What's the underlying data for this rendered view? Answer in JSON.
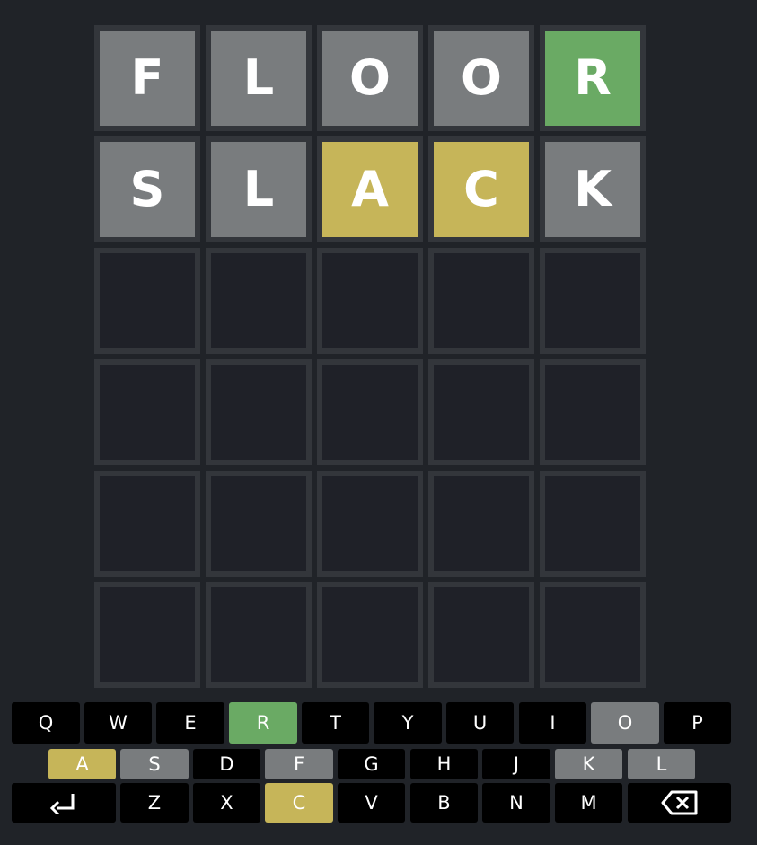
{
  "board": {
    "rows": [
      {
        "tiles": [
          {
            "letter": "F",
            "state": "absent"
          },
          {
            "letter": "L",
            "state": "absent"
          },
          {
            "letter": "O",
            "state": "absent"
          },
          {
            "letter": "O",
            "state": "absent"
          },
          {
            "letter": "R",
            "state": "correct"
          }
        ]
      },
      {
        "tiles": [
          {
            "letter": "S",
            "state": "absent"
          },
          {
            "letter": "L",
            "state": "absent"
          },
          {
            "letter": "A",
            "state": "present"
          },
          {
            "letter": "C",
            "state": "present"
          },
          {
            "letter": "K",
            "state": "absent"
          }
        ]
      },
      {
        "tiles": [
          {
            "letter": "",
            "state": "empty"
          },
          {
            "letter": "",
            "state": "empty"
          },
          {
            "letter": "",
            "state": "empty"
          },
          {
            "letter": "",
            "state": "empty"
          },
          {
            "letter": "",
            "state": "empty"
          }
        ]
      },
      {
        "tiles": [
          {
            "letter": "",
            "state": "empty"
          },
          {
            "letter": "",
            "state": "empty"
          },
          {
            "letter": "",
            "state": "empty"
          },
          {
            "letter": "",
            "state": "empty"
          },
          {
            "letter": "",
            "state": "empty"
          }
        ]
      },
      {
        "tiles": [
          {
            "letter": "",
            "state": "empty"
          },
          {
            "letter": "",
            "state": "empty"
          },
          {
            "letter": "",
            "state": "empty"
          },
          {
            "letter": "",
            "state": "empty"
          },
          {
            "letter": "",
            "state": "empty"
          }
        ]
      },
      {
        "tiles": [
          {
            "letter": "",
            "state": "empty"
          },
          {
            "letter": "",
            "state": "empty"
          },
          {
            "letter": "",
            "state": "empty"
          },
          {
            "letter": "",
            "state": "empty"
          },
          {
            "letter": "",
            "state": "empty"
          }
        ]
      }
    ]
  },
  "keyboard": {
    "rows": [
      [
        {
          "label": "Q",
          "state": "unused"
        },
        {
          "label": "W",
          "state": "unused"
        },
        {
          "label": "E",
          "state": "unused"
        },
        {
          "label": "R",
          "state": "correct"
        },
        {
          "label": "T",
          "state": "unused"
        },
        {
          "label": "Y",
          "state": "unused"
        },
        {
          "label": "U",
          "state": "unused"
        },
        {
          "label": "I",
          "state": "unused"
        },
        {
          "label": "O",
          "state": "absent"
        },
        {
          "label": "P",
          "state": "unused"
        }
      ],
      [
        {
          "label": "A",
          "state": "present"
        },
        {
          "label": "S",
          "state": "absent"
        },
        {
          "label": "D",
          "state": "unused"
        },
        {
          "label": "F",
          "state": "absent"
        },
        {
          "label": "G",
          "state": "unused"
        },
        {
          "label": "H",
          "state": "unused"
        },
        {
          "label": "J",
          "state": "unused"
        },
        {
          "label": "K",
          "state": "absent"
        },
        {
          "label": "L",
          "state": "absent"
        }
      ],
      [
        {
          "label": "",
          "icon": "enter-icon",
          "state": "unused"
        },
        {
          "label": "Z",
          "state": "unused"
        },
        {
          "label": "X",
          "state": "unused"
        },
        {
          "label": "C",
          "state": "present"
        },
        {
          "label": "V",
          "state": "unused"
        },
        {
          "label": "B",
          "state": "unused"
        },
        {
          "label": "N",
          "state": "unused"
        },
        {
          "label": "M",
          "state": "unused"
        },
        {
          "label": "",
          "icon": "backspace-icon",
          "state": "unused"
        }
      ]
    ]
  },
  "colors": {
    "background": "#202328",
    "tile_border": "#33363b",
    "absent": "#797c7e",
    "present": "#c6b559",
    "correct": "#6aaa64",
    "key_default": "#000000",
    "text": "#ffffff"
  }
}
